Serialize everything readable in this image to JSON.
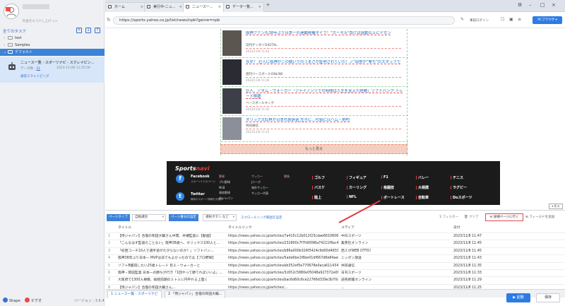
{
  "sidebar": {
    "plan_label": "料金をもう少し上げ >>",
    "tasks_title": "全てのタスク",
    "tree": [
      {
        "label": "test",
        "selected": false
      },
      {
        "label": "Samples",
        "selected": false
      },
      {
        "label": "デフォルト",
        "selected": true
      }
    ],
    "task": {
      "name": "ニュース一覧 - スポーツナビ - スクレイピン...",
      "data_label": "データ数",
      "count": "21",
      "date": "2023-11-08 11:25:59",
      "link": "通常スクレイピング"
    },
    "footer": {
      "shape": "Shape",
      "video": "ビデオ",
      "version": "バージョン : 3.6.4"
    }
  },
  "browser": {
    "tabs": [
      {
        "label": "ホーム",
        "active": false
      },
      {
        "label": "実行中-ニュ...",
        "active": false
      },
      {
        "label": "ニュース一...",
        "active": true
      },
      {
        "label": "データ一覧...",
        "active": false
      }
    ],
    "url": "https://sports.yahoo.co.jp/list/news/npb?genre=npb",
    "login_label": "事前ログイン",
    "pc_browser": "PCブラウザ"
  },
  "news": {
    "items": [
      {
        "title": "阪神ファンも38年ぶり日本一の連覇候補ダイブ！\"カーネル\"負けは感動以上にドボン",
        "source": "日刊ゲンダイDIGITAL",
        "date": "2023/11/8 11:43"
      },
      {
        "title": "なぜ？ 巨人に阪神がこの戦いでのうまさが証明されていた！ノ\"出勢が\"撃ち\"のスタッフで",
        "source": "週刊ベースボールONLINE",
        "date": "2023/11/8 11:36"
      },
      {
        "title": "巨人、アダム・ウォーカー「ジャイアンツでの時間は人生を変えた経験」ソフトバンク-トレード移籍",
        "source": "ベースボールキング",
        "date": "2023/11/8 11:35"
      },
      {
        "title": "オリックス紅林が日本代表辞退 左手に…代役に日ハム・野村",
        "source": "共同通信",
        "date": "2023/11/8 11:15"
      }
    ],
    "more_label": "もっと見る"
  },
  "footer_site": {
    "logo_main": "Sports",
    "logo_sub": "navi",
    "facebook": "Facebook",
    "facebook_sub": "スポーツナビのページ",
    "twitter": "Twitter",
    "twitter_sub": "最新のスポーツ情報をお届け",
    "col1": [
      "野球",
      "プロ野球",
      "MLB",
      "高校野球",
      "侍ジャパン"
    ],
    "col2": [
      "サッカー",
      "Jリーグ",
      "海外サッカー",
      "サッカー代表"
    ],
    "col3": [
      "競馬"
    ],
    "cats": [
      "ゴルフ",
      "フィギュア",
      "F1",
      "バレー",
      "テニス",
      "バスケ",
      "カーリング",
      "格闘技",
      "大相撲",
      "ラグビー",
      "陸上",
      "NFL",
      "ボートレース",
      "自転車",
      "Doスポーツ"
    ]
  },
  "toolbar": {
    "page_type": "ページタイプ",
    "page_type_val": "自動識別",
    "page_setting": "ページ番号の設定",
    "page_setting_val": "選択ボタン など",
    "scroll_link": "スクロールリング範囲を設定",
    "filter": "フィルター",
    "clear": "クリア",
    "detail_btn": "詳細ページに行く",
    "add_field": "フィールドを追加",
    "zoom_label": "折る"
  },
  "table": {
    "headers": [
      "タイトル",
      "タイトルリンク",
      "メディア",
      "日付"
    ],
    "rows": [
      [
        "1",
        "【侍ジャパン】合宿の和田大輔さん中間、井端監督に【動画】",
        "https://news.yahoo.co.jp/articles/7a415c12b012f23cdae6610606",
        "中日スポーツ",
        "2023/11/8 11:47"
      ],
      [
        "2",
        "「こんなはず監督たことない」阪神38歳へ、オリックス100人と...",
        "https://news.yahoo.co.jp/articles/232800c7f7fd0098a74211f8ac44",
        "集英社オンライン",
        "2023/11/8 11:45"
      ],
      [
        "3",
        "「初回コーチ10人で選手退がたがらないのか？」ソフトバン...",
        "https://news.yahoo.co.jp/articles/b86a000b326f5424c9d00d48338",
        "西スポWEB OTTO!",
        "2023/11/8 11:45"
      ],
      [
        "4",
        "阪神38年ぶり日本一 MVPは非でもよかったのでは【プロ野球】",
        "https://news.yahoo.co.jp/articles/5ade6be1f6be01df667d8e84ae88f1",
        "ニッポン放送",
        "2023/11/8 11:43"
      ],
      [
        "5",
        "ソフトB獲得したい25歳トレード 巨人・ウォーカーと",
        "https://news.yahoo.co.jp/articles/eb352ef5e770678e0aca611434f0",
        "共同通信",
        "2023/11/8 11:35"
      ],
      [
        "6",
        "阪神・岡田監督 日本一の勝ちが行き「1回やって勝てればいいよ」...",
        "https://news.yahoo.co.jp/articles/3c652c5880e05048a927372e0f0cab",
        "日刊スポーツ",
        "2023/11/8 11:33"
      ],
      [
        "7",
        "大阪府で1300人規模、総統前期のミトミに円平れる上陸く",
        "https://news.yahoo.co.jp/articles/bac6d60c6ce22766d339e3b70c0d",
        "読売新聞オンライン",
        "2023/11/8 11:29"
      ],
      [
        "8",
        "【侍ジャパン】合宿の和田大輔さん...",
        "https://news.yahoo.co.jp/articles/...",
        "...",
        "2023/11/8 11:25"
      ]
    ]
  },
  "bottom_tabs": [
    "1 ニュース一覧 - スポーツナビ",
    "2 「侍ジャパン」合宿の和田大輔..."
  ],
  "actions": {
    "execute": "▶ 起動",
    "save": "保存"
  }
}
